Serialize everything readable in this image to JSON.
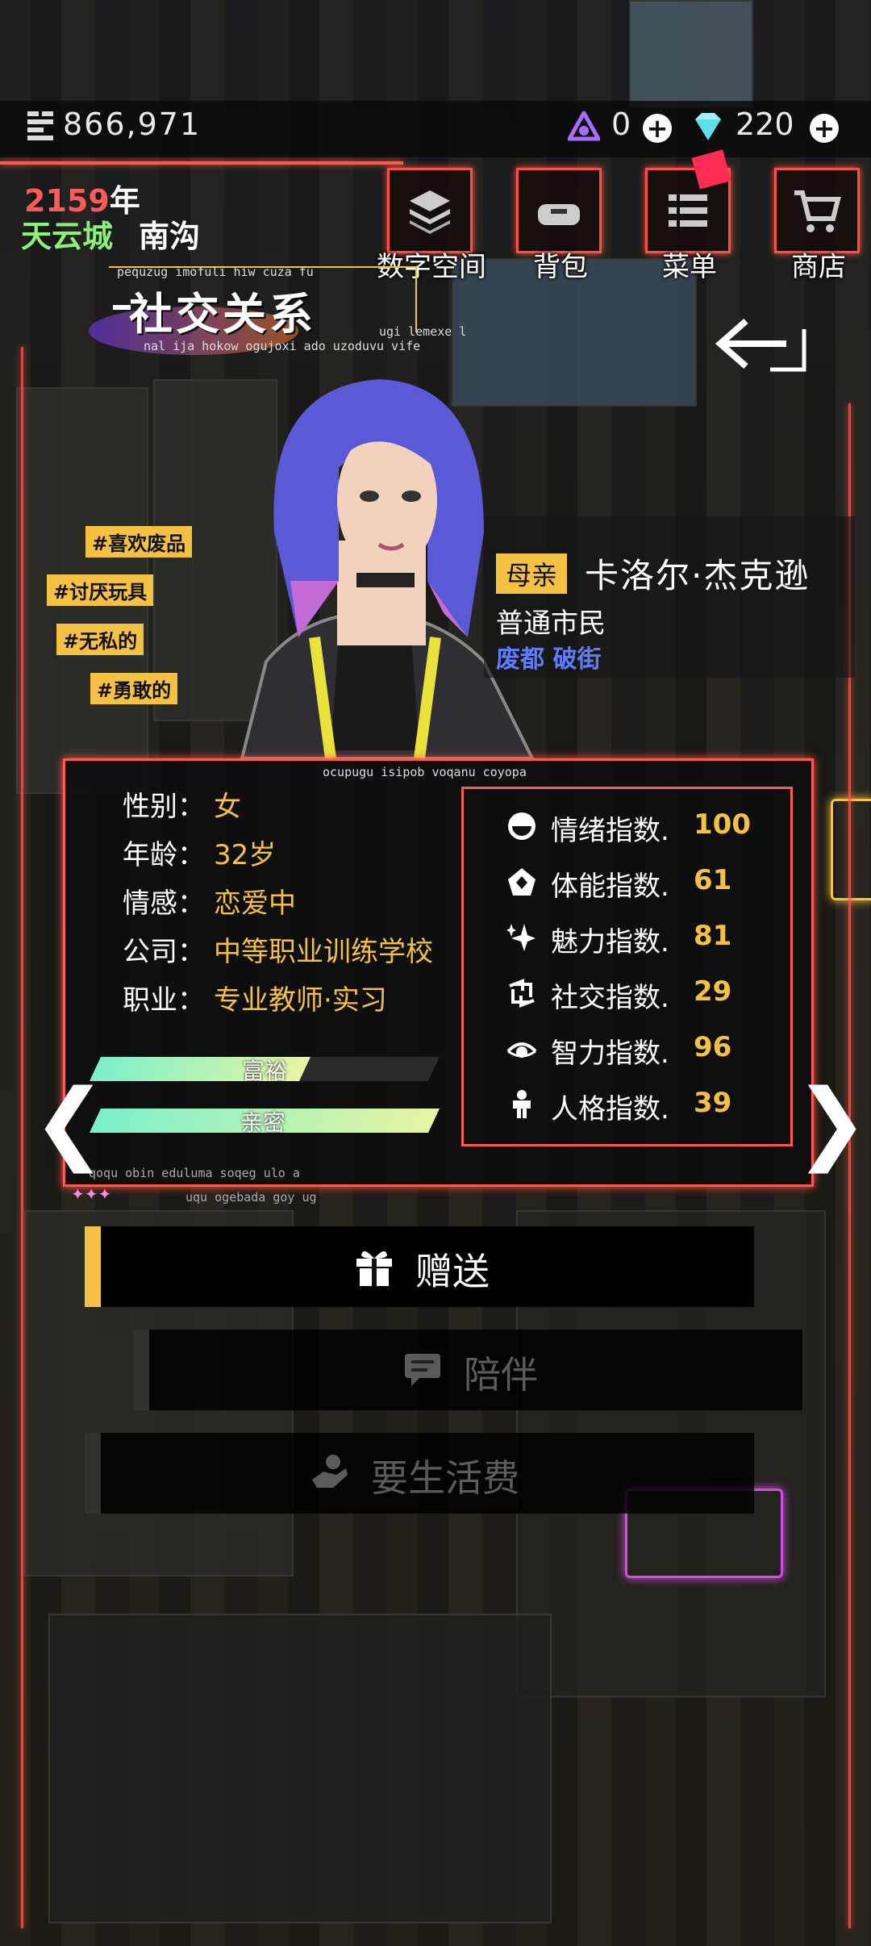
{
  "resources": {
    "money": "866,971",
    "gem_purple": "0",
    "gem_cyan": "220"
  },
  "date": {
    "year": "2159",
    "year_unit": "年",
    "city": "天云城",
    "district": "南沟"
  },
  "nav": [
    {
      "label": "数字空间",
      "icon": "layers-icon"
    },
    {
      "label": "背包",
      "icon": "bag-icon"
    },
    {
      "label": "菜单",
      "icon": "menu-icon"
    },
    {
      "label": "商店",
      "icon": "cart-icon"
    }
  ],
  "page": {
    "title": "社交关系",
    "deco_line1": "pequzug imofuli hiw cuza fu",
    "deco_line2": "nal ija hokow ogujoxi ado uzoduvu vife",
    "deco_line3": "ugi lemexe l",
    "deco_line4": "ocupugu isipob voqanu coyopa",
    "deco_line5": "qoqu obin eduluma soqeg ulo a",
    "deco_line6": "uqu ogebada goy ug"
  },
  "character": {
    "role": "母亲",
    "name": "卡洛尔·杰克逊",
    "class": "普通市民",
    "location": "废都 破街",
    "tags": [
      "#喜欢废品",
      "#讨厌玩具",
      "#无私的",
      "#勇敢的"
    ]
  },
  "attributes": [
    {
      "label": "性别：",
      "value": "女"
    },
    {
      "label": "年龄：",
      "value": "32岁"
    },
    {
      "label": "情感：",
      "value": "恋爱中"
    },
    {
      "label": "公司：",
      "value": "中等职业训练学校"
    },
    {
      "label": "职业：",
      "value": "专业教师·实习"
    }
  ],
  "indices": [
    {
      "label": "情绪指数.",
      "value": "100",
      "icon": "mood-icon"
    },
    {
      "label": "体能指数.",
      "value": "61",
      "icon": "stamina-icon"
    },
    {
      "label": "魅力指数.",
      "value": "81",
      "icon": "sparkle-icon"
    },
    {
      "label": "社交指数.",
      "value": "29",
      "icon": "social-icon"
    },
    {
      "label": "智力指数.",
      "value": "96",
      "icon": "eye-icon"
    },
    {
      "label": "人格指数.",
      "value": "39",
      "icon": "person-icon"
    }
  ],
  "bars": [
    {
      "label": "富裕",
      "fill": 0.62
    },
    {
      "label": "亲密",
      "fill": 1.0
    }
  ],
  "actions": [
    {
      "label": "赠送",
      "icon": "gift-icon",
      "enabled": true
    },
    {
      "label": "陪伴",
      "icon": "chat-icon",
      "enabled": false
    },
    {
      "label": "要生活费",
      "icon": "hand-coin-icon",
      "enabled": false
    }
  ],
  "colors": {
    "accent": "#ff5a4e",
    "highlight": "#f5c142",
    "location": "#5f7cff"
  }
}
